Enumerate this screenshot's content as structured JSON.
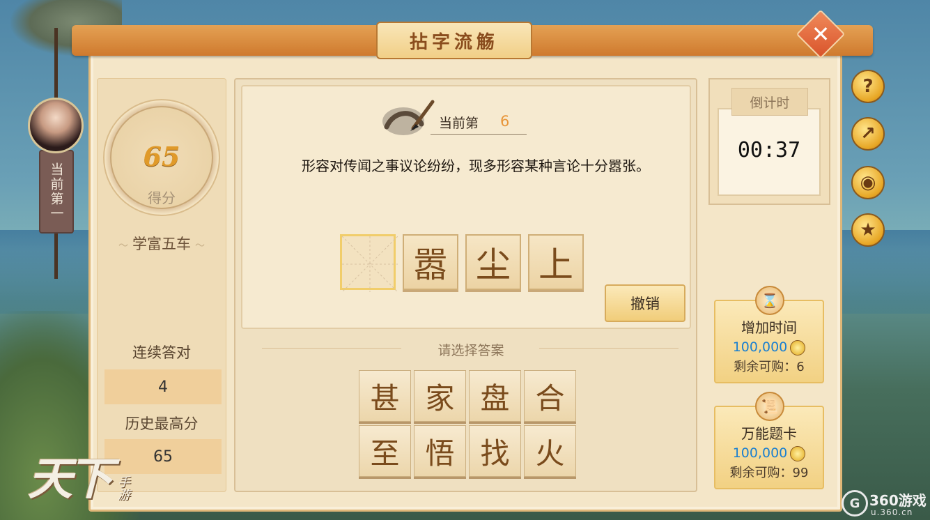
{
  "game": {
    "title": "拈字流觞",
    "close_icon": "close-icon"
  },
  "player": {
    "rank_text": "当前第一",
    "score": "65",
    "score_label": "得分",
    "title": "学富五车",
    "streak_label": "连续答对",
    "streak": "4",
    "best_label": "历史最高分",
    "best": "65"
  },
  "question": {
    "current_label": "当前第",
    "current_num": "6",
    "text": "形容对传闻之事议论纷纷，现多形容某种言论十分嚣张。",
    "slots": [
      "",
      "嚣",
      "尘",
      "上"
    ],
    "undo_label": "撤销"
  },
  "choices": {
    "label": "请选择答案",
    "chars": [
      "甚",
      "家",
      "盘",
      "合",
      "至",
      "悟",
      "找",
      "火"
    ]
  },
  "timer": {
    "label": "倒计时",
    "value": "00:37"
  },
  "side_buttons": [
    {
      "icon": "help-icon",
      "glyph": "?"
    },
    {
      "icon": "share-icon",
      "glyph": "↗"
    },
    {
      "icon": "eye-icon",
      "glyph": "◉"
    },
    {
      "icon": "ranking-icon",
      "glyph": "★"
    }
  ],
  "shop": [
    {
      "name": "增加时间",
      "price": "100,000",
      "remaining": "剩余可购：6",
      "icon": "hourglass-icon"
    },
    {
      "name": "万能题卡",
      "price": "100,000",
      "remaining": "剩余可购：99",
      "icon": "scroll-card-icon"
    }
  ],
  "branding": {
    "logo_main": "天下",
    "logo_sub": "手游",
    "watermark_text": "360游戏",
    "watermark_url": "u.360.cn"
  },
  "colors": {
    "accent_orange": "#e8963a",
    "price_blue": "#1a7fd0",
    "close_red": "#d9542b"
  }
}
